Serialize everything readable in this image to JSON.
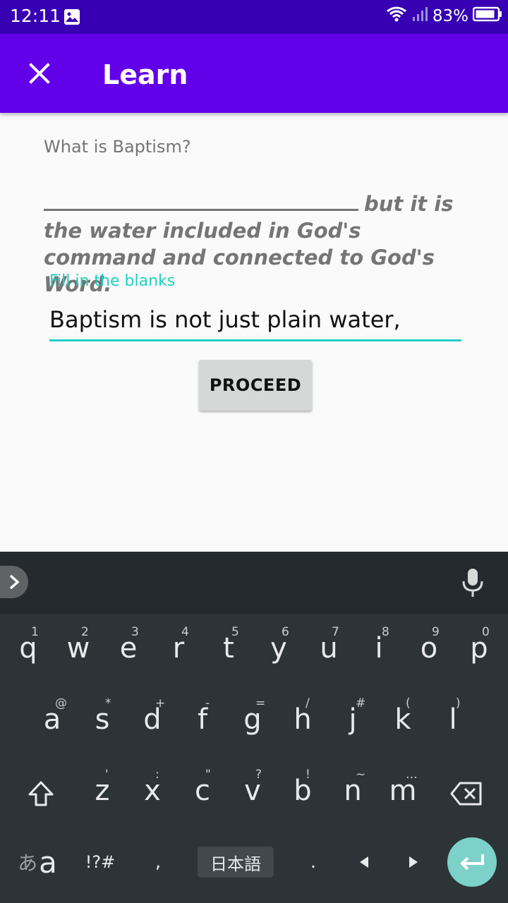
{
  "status_bar": {
    "time": "12:11",
    "battery": "83%"
  },
  "app_bar": {
    "title": "Learn"
  },
  "content": {
    "question": "What is Baptism?",
    "statement_tail_line1": "but it is",
    "statement_rest": "the water included in God's command and connected to God's Word.",
    "field_label": "Fill in the blanks",
    "answer_value": "Baptism is not just plain water,",
    "proceed_label": "PROCEED"
  },
  "keyboard": {
    "row1": [
      {
        "key": "q",
        "hint": "1"
      },
      {
        "key": "w",
        "hint": "2"
      },
      {
        "key": "e",
        "hint": "3"
      },
      {
        "key": "r",
        "hint": "4"
      },
      {
        "key": "t",
        "hint": "5"
      },
      {
        "key": "y",
        "hint": "6"
      },
      {
        "key": "u",
        "hint": "7"
      },
      {
        "key": "i",
        "hint": "8"
      },
      {
        "key": "o",
        "hint": "9"
      },
      {
        "key": "p",
        "hint": "0"
      }
    ],
    "row2": [
      {
        "key": "a",
        "hint": "@"
      },
      {
        "key": "s",
        "hint": "*"
      },
      {
        "key": "d",
        "hint": "+"
      },
      {
        "key": "f",
        "hint": "-"
      },
      {
        "key": "g",
        "hint": "="
      },
      {
        "key": "h",
        "hint": "/"
      },
      {
        "key": "j",
        "hint": "#"
      },
      {
        "key": "k",
        "hint": "("
      },
      {
        "key": "l",
        "hint": ")"
      }
    ],
    "row3": [
      {
        "key": "z",
        "hint": "'"
      },
      {
        "key": "x",
        "hint": ":"
      },
      {
        "key": "c",
        "hint": "\""
      },
      {
        "key": "v",
        "hint": "?"
      },
      {
        "key": "b",
        "hint": "!"
      },
      {
        "key": "n",
        "hint": "~"
      },
      {
        "key": "m",
        "hint": "…"
      }
    ],
    "kana_small": "あ",
    "kana_big": "a",
    "symbols": "!?#",
    "comma": ",",
    "language": "日本語",
    "period": "."
  },
  "colors": {
    "status_bar": "#3700b3",
    "app_bar": "#6200ea",
    "accent": "#1fd1c2",
    "enter": "#7cd1c8"
  }
}
